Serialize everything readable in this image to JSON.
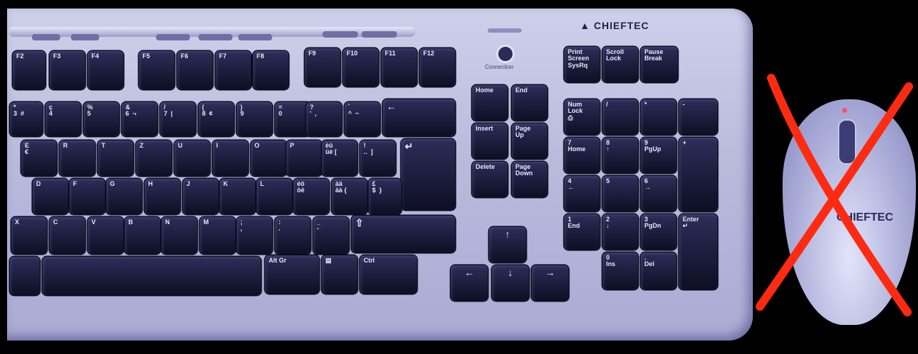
{
  "keyboard": {
    "brand": "CHIEFTEC",
    "connection_label": "Connection",
    "function_keys": [
      "F2",
      "F3",
      "F4",
      "F5",
      "F6",
      "F7",
      "F8",
      "F9",
      "F10",
      "F11",
      "F12"
    ],
    "system_keys": [
      "Print\nScreen\nSysRq",
      "Scroll\nLock",
      "Pause\nBreak"
    ],
    "nav_keys": [
      "Home",
      "End",
      "Insert",
      "Page\nUp",
      "Delete",
      "Page\nDown"
    ],
    "arrow_keys": [
      "↑",
      "←",
      "↓",
      "→"
    ],
    "numpad_keys": [
      "Num\nLock\n⎙",
      "/",
      "*",
      "-",
      "7\nHome",
      "8\n↑",
      "9\nPgUp",
      "+",
      "4\n←",
      "5",
      "6\n→",
      "1\nEnd",
      "2\n↓",
      "3\nPgDn",
      "Enter\n↵",
      "0\nIns",
      ".\nDel"
    ],
    "num_row": [
      "*\n3  #",
      "ç\n4",
      "%\n5",
      "&\n6  ¬",
      "/\n7  |",
      "(\n8  ¢",
      ")\n9",
      "=\n0",
      "?\n'  ,",
      "`\n^  ~",
      "←"
    ],
    "top_alpha_row": [
      "E\n€",
      "R",
      "T",
      "Z",
      "U",
      "I",
      "O",
      "P",
      "èü\nüè [",
      "!\n..  ]",
      "↵"
    ],
    "home_row": [
      "D",
      "F",
      "G",
      "H",
      "J",
      "K",
      "L",
      "éö\nöé",
      "àä\näà {",
      "£\n$  }"
    ],
    "bottom_row": [
      "X",
      "C",
      "V",
      "B",
      "N",
      "M",
      ";\n,",
      ":\n.",
      "_\n-",
      "⇧"
    ],
    "modifier_keys": [
      "Alt Gr",
      "▤",
      "Ctrl"
    ]
  },
  "mouse": {
    "brand": "CHIEFTEC"
  },
  "overlay": {
    "mark": "cross",
    "color": "#ff2a12"
  }
}
